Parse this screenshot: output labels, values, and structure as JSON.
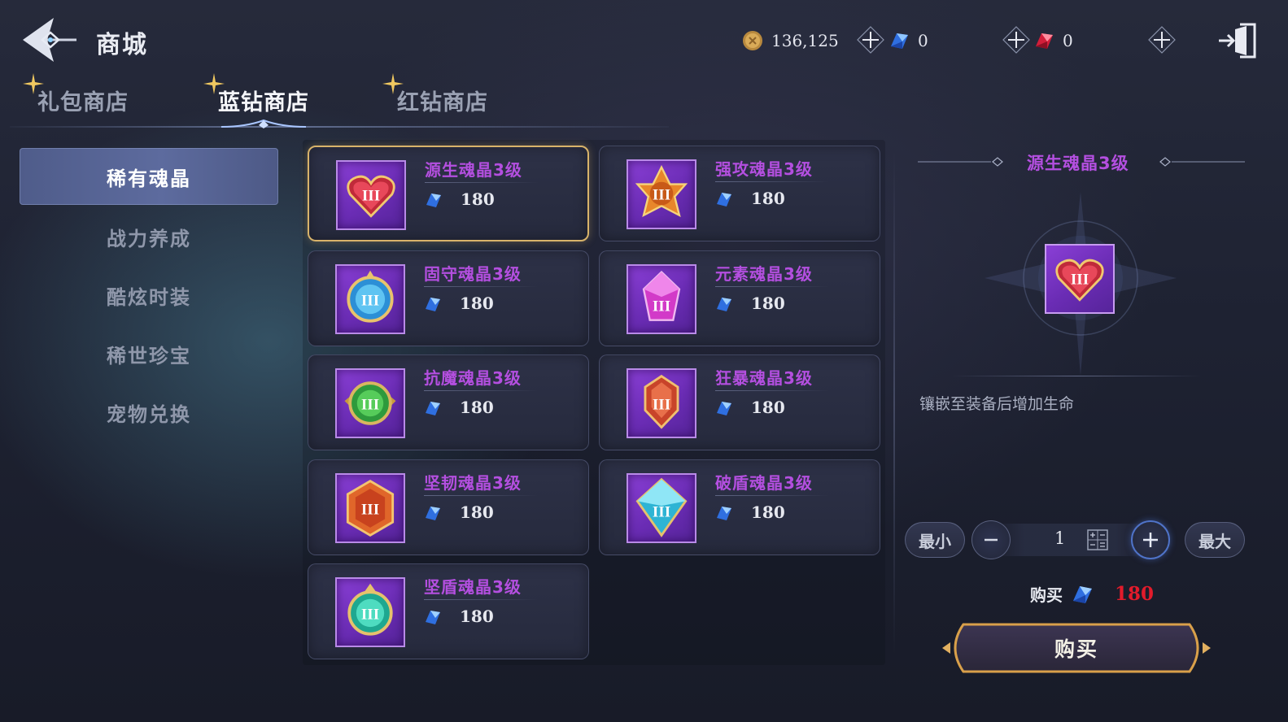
{
  "header": {
    "title": "商城",
    "back_icon": "back-arrow-icon",
    "exit_icon": "exit-door-icon",
    "currencies": [
      {
        "name": "gold-coin-icon",
        "value": "136,125"
      },
      {
        "name": "blue-diamond-icon",
        "value": "0"
      },
      {
        "name": "red-diamond-icon",
        "value": "0"
      }
    ]
  },
  "tabs": [
    {
      "label": "礼包商店",
      "active": false
    },
    {
      "label": "蓝钻商店",
      "active": true
    },
    {
      "label": "红钻商店",
      "active": false
    }
  ],
  "sidebar": {
    "items": [
      {
        "label": "稀有魂晶",
        "active": true
      },
      {
        "label": "战力养成",
        "active": false
      },
      {
        "label": "酷炫时装",
        "active": false
      },
      {
        "label": "稀世珍宝",
        "active": false
      },
      {
        "label": "宠物兑换",
        "active": false
      }
    ]
  },
  "items": [
    {
      "name": "源生魂晶3级",
      "price": "180",
      "icon": "heart-crystal-icon",
      "selected": true
    },
    {
      "name": "强攻魂晶3级",
      "price": "180",
      "icon": "flame-crystal-icon",
      "selected": false
    },
    {
      "name": "固守魂晶3级",
      "price": "180",
      "icon": "blue-shield-crystal-icon",
      "selected": false
    },
    {
      "name": "元素魂晶3级",
      "price": "180",
      "icon": "magenta-gem-crystal-icon",
      "selected": false
    },
    {
      "name": "抗魔魂晶3级",
      "price": "180",
      "icon": "green-shield-crystal-icon",
      "selected": false
    },
    {
      "name": "狂暴魂晶3级",
      "price": "180",
      "icon": "red-rage-crystal-icon",
      "selected": false
    },
    {
      "name": "坚韧魂晶3级",
      "price": "180",
      "icon": "orange-hex-crystal-icon",
      "selected": false
    },
    {
      "name": "破盾魂晶3级",
      "price": "180",
      "icon": "cyan-diamond-crystal-icon",
      "selected": false
    },
    {
      "name": "坚盾魂晶3级",
      "price": "180",
      "icon": "teal-round-crystal-icon",
      "selected": false
    }
  ],
  "detail": {
    "title": "源生魂晶3级",
    "icon": "heart-crystal-icon",
    "description": "镶嵌至装备后增加生命",
    "min_label": "最小",
    "max_label": "最大",
    "quantity": "1",
    "buy_label": "购买",
    "cost": "180",
    "buy_button": "购买"
  },
  "colors": {
    "item_name": "#b44fe0",
    "cost_red": "#e21b2b",
    "selected_border": "#d8b36a",
    "icon_bg": "#7a35c6"
  }
}
